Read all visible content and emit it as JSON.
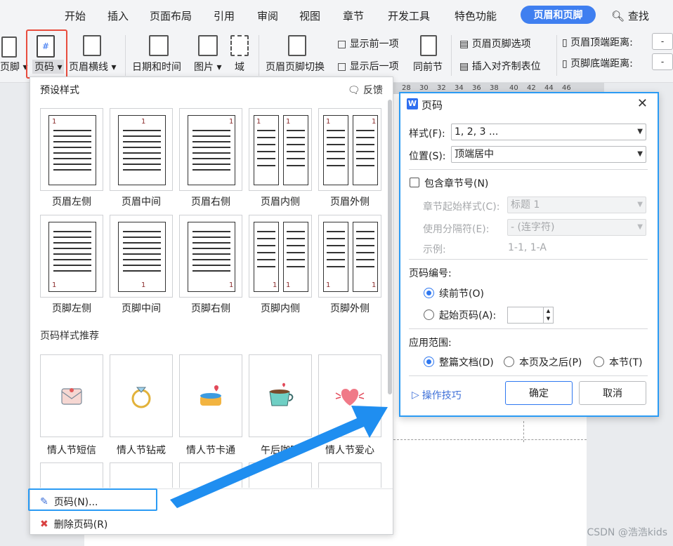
{
  "menubar": {
    "items": [
      "开始",
      "插入",
      "页面布局",
      "引用",
      "审阅",
      "视图",
      "章节",
      "开发工具",
      "特色功能"
    ],
    "active_tab": "页眉和页脚",
    "search_label": "查找"
  },
  "ribbon": {
    "footer_label": "页脚",
    "page_number_label": "页码",
    "header_line_label": "页眉横线",
    "datetime_label": "日期和时间",
    "picture_label": "图片",
    "field_label": "域",
    "switch_label": "页眉页脚切换",
    "show_prev_label": "显示前一项",
    "show_next_label": "显示后一项",
    "same_section_label": "同前节",
    "options_label": "页眉页脚选项",
    "insert_tab_label": "插入对齐制表位",
    "header_top_label": "页眉顶端距离:",
    "footer_bottom_label": "页脚底端距离:",
    "header_top_value": "-",
    "footer_bottom_value": "-"
  },
  "ruler": {
    "ticks": [
      "28",
      "30",
      "32",
      "34",
      "36",
      "38",
      "40",
      "42",
      "44",
      "46"
    ]
  },
  "panel": {
    "title": "预设样式",
    "feedback": "反馈",
    "header_styles": [
      "页眉左侧",
      "页眉中间",
      "页眉右侧",
      "页眉内侧",
      "页眉外侧"
    ],
    "footer_styles": [
      "页脚左侧",
      "页脚中间",
      "页脚右侧",
      "页脚内侧",
      "页脚外侧"
    ],
    "recommend_title": "页码样式推荐",
    "recommend_styles": [
      "情人节短信",
      "情人节钻戒",
      "情人节卡通",
      "午后咖啡",
      "情人节爱心"
    ],
    "page_num_menu": "页码(N)...",
    "delete_page_num": "删除页码(R)",
    "thumb_number": "1"
  },
  "dialog": {
    "title": "页码",
    "style_label": "样式(F):",
    "style_value": "1, 2, 3 ...",
    "position_label": "位置(S):",
    "position_value": "顶端居中",
    "include_chapter": "包含章节号(N)",
    "chapter_start_label": "章节起始样式(C):",
    "chapter_start_value": "标题 1",
    "separator_label": "使用分隔符(E):",
    "separator_value": "-    (连字符)",
    "example_label": "示例:",
    "example_value": "1-1, 1-A",
    "numbering_title": "页码编号:",
    "continue_prev": "续前节(O)",
    "start_at": "起始页码(A):",
    "scope_title": "应用范围:",
    "scope_whole": "整篇文档(D)",
    "scope_after": "本页及之后(P)",
    "scope_section": "本节(T)",
    "tips": "操作技巧",
    "ok": "确定",
    "cancel": "取消"
  },
  "watermark": "CSDN @浩浩kids"
}
